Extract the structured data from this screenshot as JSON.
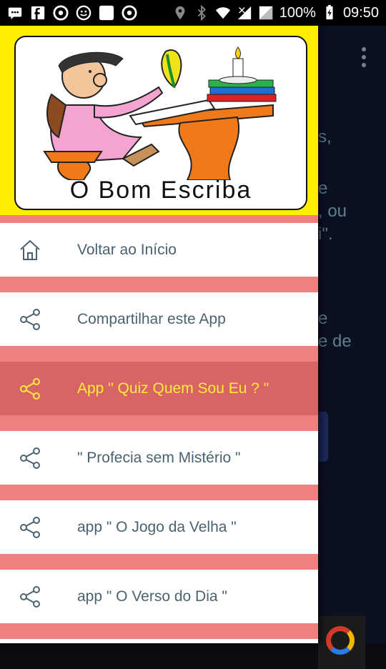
{
  "status_bar": {
    "battery": "100%",
    "time": "09:50",
    "icons": [
      "message-icon",
      "facebook-icon",
      "chrome-icon",
      "smiley-icon",
      "blank-app-icon",
      "chrome-icon",
      "location-icon",
      "bluetooth-icon",
      "wifi-icon",
      "signal-icon",
      "battery-icon"
    ]
  },
  "drawer": {
    "header": {
      "logo_title": "O Bom Escriba"
    },
    "items": [
      {
        "label": "Voltar ao Início",
        "icon": "home-icon"
      },
      {
        "label": "Compartilhar este App",
        "icon": "share-icon"
      },
      {
        "label": "App \" Quiz Quem Sou Eu ? \"",
        "icon": "share-icon",
        "selected": true
      },
      {
        "label": "\" Profecia sem Mistério \"",
        "icon": "share-icon"
      },
      {
        "label": "app \" O Jogo da Velha \"",
        "icon": "share-icon"
      },
      {
        "label": "app \" O Verso do Dia \"",
        "icon": "share-icon"
      }
    ]
  },
  "background_fragments": [
    "s,",
    "e",
    ", ou",
    "i\".",
    "e",
    "e de"
  ],
  "colors": {
    "header_yellow": "#ffee00",
    "separator": "#f08080",
    "selected_bg": "#d86464",
    "selected_text": "#ffec3a",
    "item_text": "#4a6270"
  }
}
